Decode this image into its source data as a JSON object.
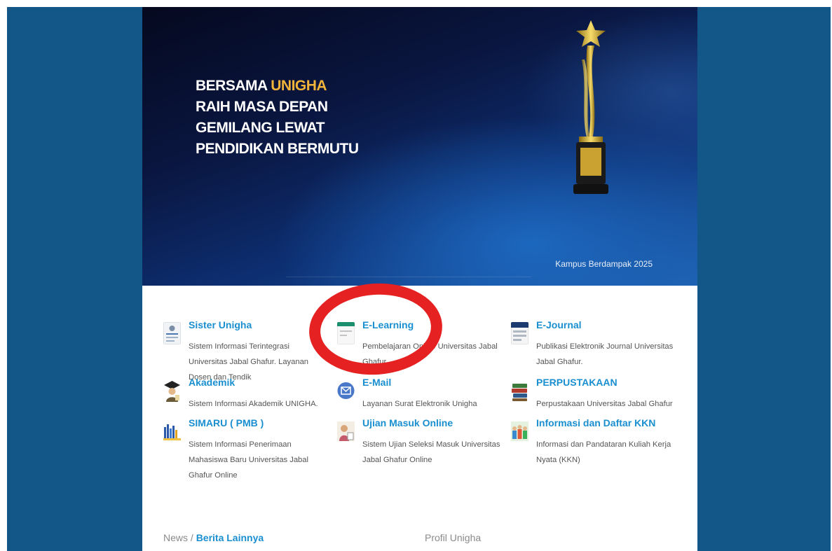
{
  "hero": {
    "line1_prefix": "BERSAMA ",
    "line1_accent": "UNIGHA",
    "line2": "RAIH MASA DEPAN",
    "line3": "GEMILANG LEWAT",
    "line4": "PENDIDIKAN BERMUTU",
    "caption": "Kampus Berdampak 2025",
    "accent_color": "#f0b43a"
  },
  "services": [
    {
      "icon": "sister-icon",
      "title": "Sister Unigha",
      "desc": "Sistem Informasi Terintegrasi Universitas Jabal Ghafur. Layanan Dosen dan Tendik"
    },
    {
      "icon": "elearning-icon",
      "title": "E-Learning",
      "desc": "Pembelajaran Online Universitas Jabal Ghafur"
    },
    {
      "icon": "ejournal-icon",
      "title": "E-Journal",
      "desc": "Publikasi Elektronik Journal Universitas Jabal Ghafur."
    },
    {
      "icon": "graduate-icon",
      "title": "Akademik",
      "desc": "Sistem Informasi Akademik UNIGHA."
    },
    {
      "icon": "mail-icon",
      "title": "E-Mail",
      "desc": "Layanan Surat Elektronik Unigha"
    },
    {
      "icon": "books-icon",
      "title": "PERPUSTAKAAN",
      "desc": "Perpustakaan Universitas Jabal Ghafur"
    },
    {
      "icon": "pmb-icon",
      "title": "SIMARU ( PMB )",
      "desc": "Sistem Informasi Penerimaan Mahasiswa Baru Universitas Jabal Ghafur Online"
    },
    {
      "icon": "exam-icon",
      "title": "Ujian Masuk Online",
      "desc": "Sistem Ujian Seleksi Masuk Universitas Jabal Ghafur Online"
    },
    {
      "icon": "kkn-icon",
      "title": "Informasi dan Daftar KKN",
      "desc": "Informasi dan Pandataran Kuliah Kerja Nyata (KKN)"
    }
  ],
  "footer": {
    "news_prefix": "News / ",
    "news_link": "Berita Lainnya",
    "profile": "Profil Unigha"
  },
  "colors": {
    "outer_bg": "#135788",
    "link": "#1a8fd0",
    "annotation": "#e52121"
  }
}
